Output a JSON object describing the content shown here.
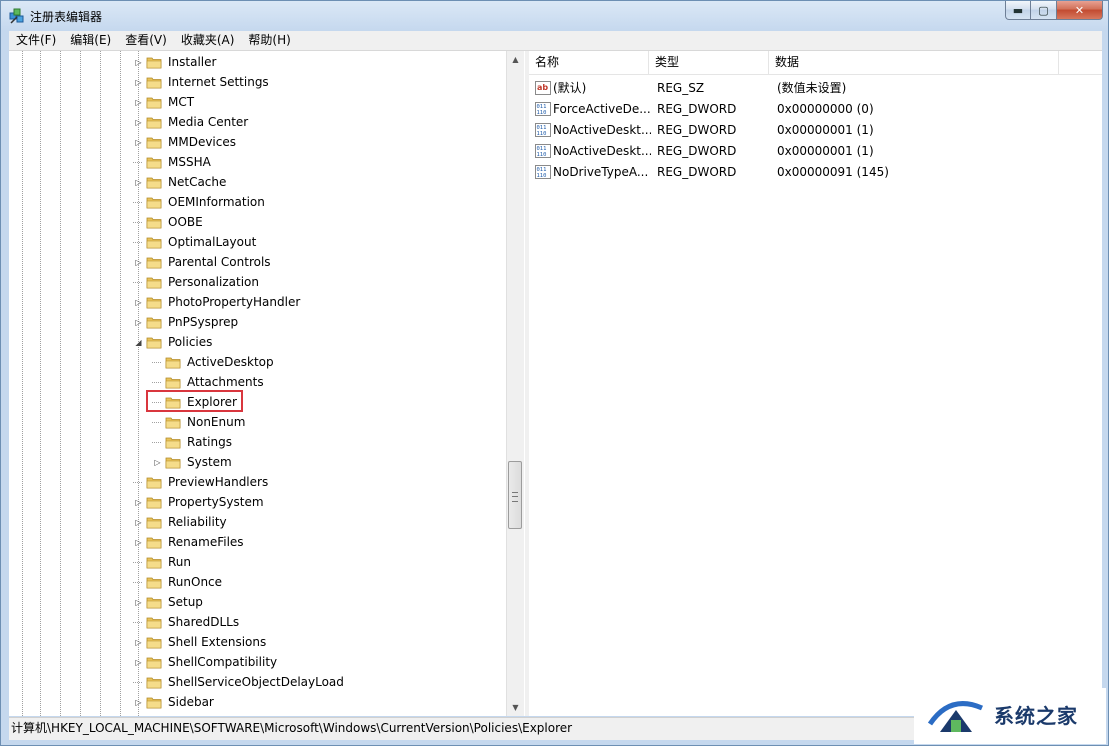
{
  "window": {
    "title": "注册表编辑器"
  },
  "menu": [
    "文件(F)",
    "编辑(E)",
    "查看(V)",
    "收藏夹(A)",
    "帮助(H)"
  ],
  "tree": {
    "items": [
      {
        "label": "Installer",
        "level": 1,
        "expander": "collapsed"
      },
      {
        "label": "Internet Settings",
        "level": 1,
        "expander": "collapsed"
      },
      {
        "label": "MCT",
        "level": 1,
        "expander": "collapsed"
      },
      {
        "label": "Media Center",
        "level": 1,
        "expander": "collapsed"
      },
      {
        "label": "MMDevices",
        "level": 1,
        "expander": "collapsed"
      },
      {
        "label": "MSSHA",
        "level": 1,
        "expander": "none"
      },
      {
        "label": "NetCache",
        "level": 1,
        "expander": "collapsed"
      },
      {
        "label": "OEMInformation",
        "level": 1,
        "expander": "none"
      },
      {
        "label": "OOBE",
        "level": 1,
        "expander": "none"
      },
      {
        "label": "OptimalLayout",
        "level": 1,
        "expander": "none"
      },
      {
        "label": "Parental Controls",
        "level": 1,
        "expander": "collapsed"
      },
      {
        "label": "Personalization",
        "level": 1,
        "expander": "none"
      },
      {
        "label": "PhotoPropertyHandler",
        "level": 1,
        "expander": "collapsed"
      },
      {
        "label": "PnPSysprep",
        "level": 1,
        "expander": "collapsed"
      },
      {
        "label": "Policies",
        "level": 1,
        "expander": "expanded"
      },
      {
        "label": "ActiveDesktop",
        "level": 2,
        "expander": "none"
      },
      {
        "label": "Attachments",
        "level": 2,
        "expander": "none"
      },
      {
        "label": "Explorer",
        "level": 2,
        "expander": "none",
        "selected": true
      },
      {
        "label": "NonEnum",
        "level": 2,
        "expander": "none"
      },
      {
        "label": "Ratings",
        "level": 2,
        "expander": "none"
      },
      {
        "label": "System",
        "level": 2,
        "expander": "collapsed"
      },
      {
        "label": "PreviewHandlers",
        "level": 1,
        "expander": "none"
      },
      {
        "label": "PropertySystem",
        "level": 1,
        "expander": "collapsed"
      },
      {
        "label": "Reliability",
        "level": 1,
        "expander": "collapsed"
      },
      {
        "label": "RenameFiles",
        "level": 1,
        "expander": "collapsed"
      },
      {
        "label": "Run",
        "level": 1,
        "expander": "none"
      },
      {
        "label": "RunOnce",
        "level": 1,
        "expander": "none"
      },
      {
        "label": "Setup",
        "level": 1,
        "expander": "collapsed"
      },
      {
        "label": "SharedDLLs",
        "level": 1,
        "expander": "none"
      },
      {
        "label": "Shell Extensions",
        "level": 1,
        "expander": "collapsed"
      },
      {
        "label": "ShellCompatibility",
        "level": 1,
        "expander": "collapsed"
      },
      {
        "label": "ShellServiceObjectDelayLoad",
        "level": 1,
        "expander": "none"
      },
      {
        "label": "Sidebar",
        "level": 1,
        "expander": "collapsed"
      }
    ]
  },
  "list": {
    "columns": [
      "名称",
      "类型",
      "数据"
    ],
    "rows": [
      {
        "icon": "string-value-icon",
        "name": "(默认)",
        "type": "REG_SZ",
        "data": "(数值未设置)"
      },
      {
        "icon": "binary-value-icon",
        "name": "ForceActiveDe...",
        "type": "REG_DWORD",
        "data": "0x00000000 (0)"
      },
      {
        "icon": "binary-value-icon",
        "name": "NoActiveDeskt...",
        "type": "REG_DWORD",
        "data": "0x00000001 (1)"
      },
      {
        "icon": "binary-value-icon",
        "name": "NoActiveDeskt...",
        "type": "REG_DWORD",
        "data": "0x00000001 (1)"
      },
      {
        "icon": "binary-value-icon",
        "name": "NoDriveTypeA...",
        "type": "REG_DWORD",
        "data": "0x00000091 (145)"
      }
    ]
  },
  "status": {
    "path": "计算机\\HKEY_LOCAL_MACHINE\\SOFTWARE\\Microsoft\\Windows\\CurrentVersion\\Policies\\Explorer"
  },
  "watermark": {
    "text": "系统之家"
  },
  "colors": {
    "selection_box": "#d9363e",
    "folder": "#e8c35a",
    "accent": "#1b3a6b"
  }
}
